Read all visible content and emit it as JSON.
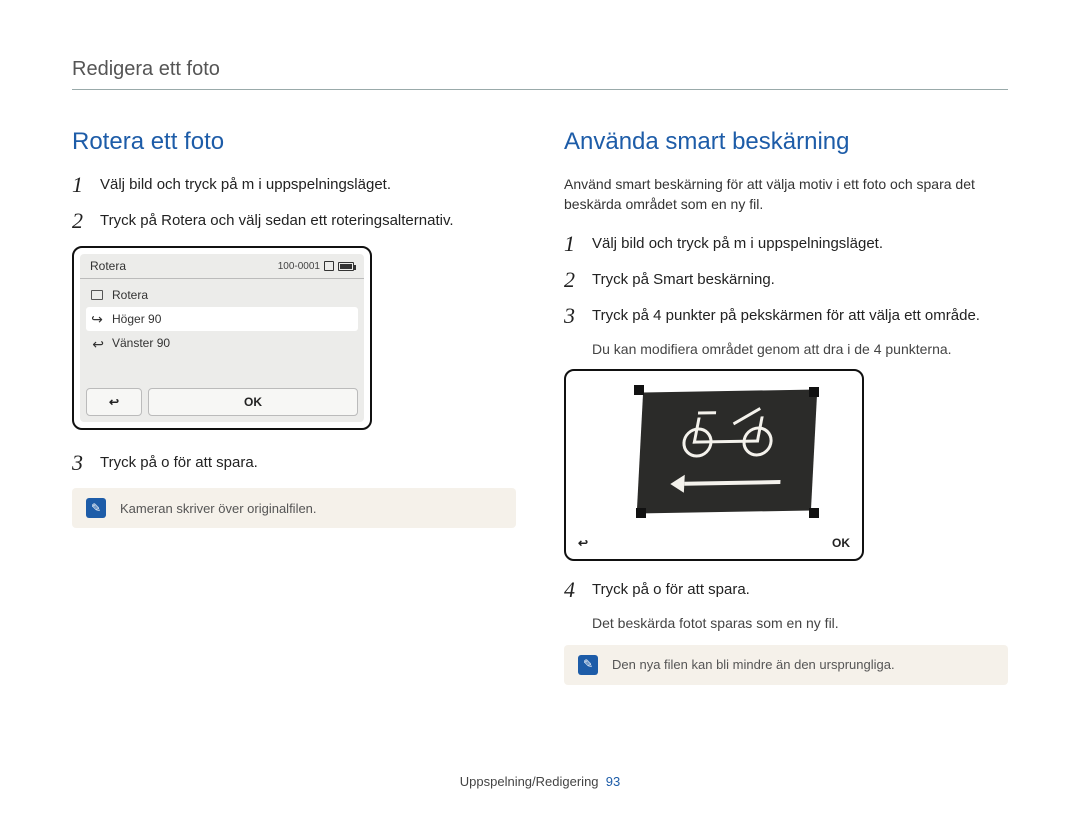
{
  "breadcrumb": "Redigera ett foto",
  "left": {
    "title": "Rotera ett foto",
    "step1": "Välj bild och tryck på m i uppspelningsläget.",
    "step2": "Tryck på Rotera och välj sedan ett roteringsalternativ.",
    "device": {
      "title": "Rotera",
      "counter": "100-0001",
      "options": [
        {
          "label": "Rotera"
        },
        {
          "label": "Höger 90"
        },
        {
          "label": "Vänster 90"
        }
      ],
      "ok": "OK",
      "back_glyph": "↩"
    },
    "step3": "Tryck på o för att spara.",
    "note": "Kameran skriver över originalfilen."
  },
  "right": {
    "title": "Använda smart beskärning",
    "intro": "Använd smart beskärning för att välja motiv i ett foto och spara det beskärda området som en ny fil.",
    "step1": "Välj bild och tryck på m i uppspelningsläget.",
    "step2": "Tryck på Smart beskärning.",
    "step3": "Tryck på 4 punkter på pekskärmen för att välja ett område.",
    "step3_sub": "Du kan modifiera området genom att dra i de 4 punkterna.",
    "device": {
      "ok": "OK",
      "back_glyph": "↩"
    },
    "step4": "Tryck på o för att spara.",
    "step4_sub": "Det beskärda fotot sparas som en ny fil.",
    "note": "Den nya filen kan bli mindre än den ursprungliga."
  },
  "footer": {
    "section": "Uppspelning/Redigering",
    "page": "93"
  }
}
